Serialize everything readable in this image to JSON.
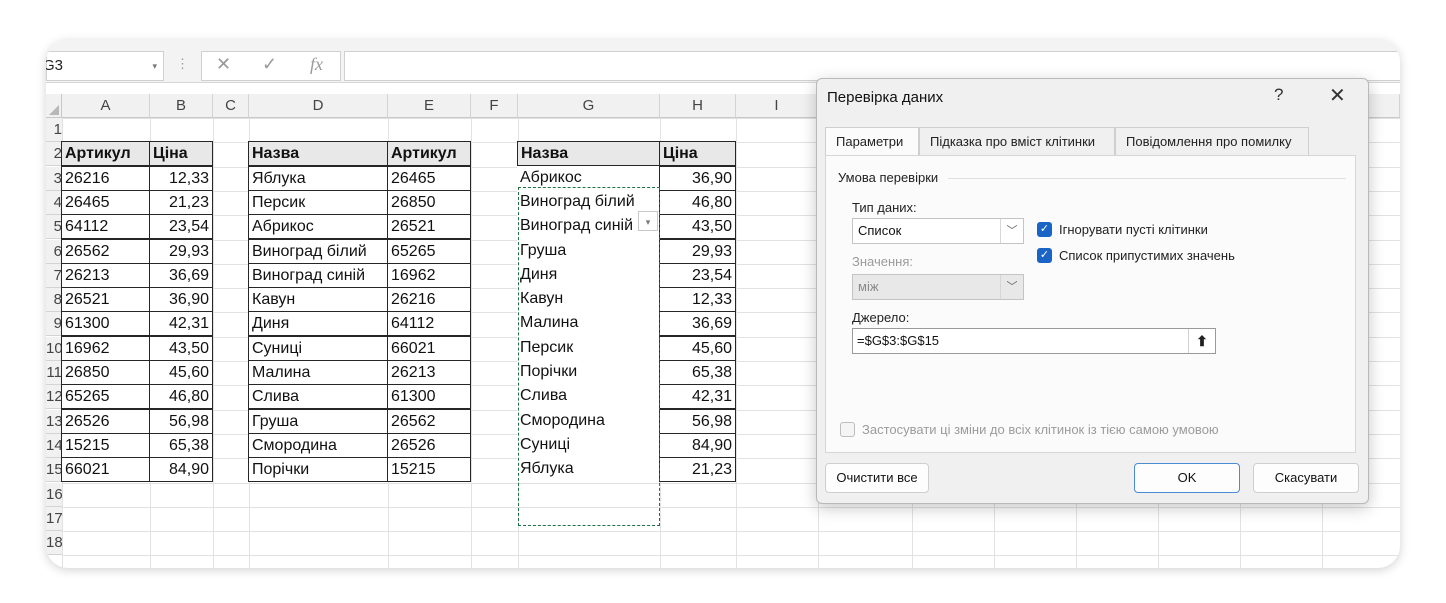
{
  "formula_bar": {
    "name_box": "G3",
    "fx": "fx",
    "cancel_glyph": "✕",
    "enter_glyph": "✓",
    "dropdown_glyph": "▾",
    "separator": "⋮"
  },
  "columns": [
    "A",
    "B",
    "C",
    "D",
    "E",
    "F",
    "G",
    "H",
    "I"
  ],
  "rows": [
    "1",
    "2",
    "3",
    "4",
    "5",
    "6",
    "7",
    "8",
    "9",
    "10",
    "11",
    "12",
    "13",
    "14",
    "15",
    "16",
    "17",
    "18"
  ],
  "table1": {
    "headers": [
      "Артикул",
      "Ціна"
    ],
    "rows": [
      [
        "26216",
        "12,33"
      ],
      [
        "26465",
        "21,23"
      ],
      [
        "64112",
        "23,54"
      ],
      [
        "26562",
        "29,93"
      ],
      [
        "26213",
        "36,69"
      ],
      [
        "26521",
        "36,90"
      ],
      [
        "61300",
        "42,31"
      ],
      [
        "16962",
        "43,50"
      ],
      [
        "26850",
        "45,60"
      ],
      [
        "65265",
        "46,80"
      ],
      [
        "26526",
        "56,98"
      ],
      [
        "15215",
        "65,38"
      ],
      [
        "66021",
        "84,90"
      ]
    ]
  },
  "table2": {
    "headers": [
      "Назва",
      "Артикул"
    ],
    "rows": [
      [
        "Яблука",
        "26465"
      ],
      [
        "Персик",
        "26850"
      ],
      [
        "Абрикос",
        "26521"
      ],
      [
        "Виноград білий",
        "65265"
      ],
      [
        "Виноград синій",
        "16962"
      ],
      [
        "Кавун",
        "26216"
      ],
      [
        "Диня",
        "64112"
      ],
      [
        "Суниці",
        "66021"
      ],
      [
        "Малина",
        "26213"
      ],
      [
        "Слива",
        "61300"
      ],
      [
        "Груша",
        "26562"
      ],
      [
        "Смородина",
        "26526"
      ],
      [
        "Порічки",
        "15215"
      ]
    ]
  },
  "table3": {
    "headers": [
      "Назва",
      "Ціна"
    ],
    "rows": [
      [
        "Абрикос",
        "36,90"
      ],
      [
        "Виноград білий",
        "46,80"
      ],
      [
        "Виноград синій",
        "43,50"
      ],
      [
        "Груша",
        "29,93"
      ],
      [
        "Диня",
        "23,54"
      ],
      [
        "Кавун",
        "12,33"
      ],
      [
        "Малина",
        "36,69"
      ],
      [
        "Персик",
        "45,60"
      ],
      [
        "Порічки",
        "65,38"
      ],
      [
        "Слива",
        "42,31"
      ],
      [
        "Смородина",
        "56,98"
      ],
      [
        "Суниці",
        "84,90"
      ],
      [
        "Яблука",
        "21,23"
      ]
    ]
  },
  "dialog": {
    "title": "Перевірка даних",
    "help": "?",
    "close": "✕",
    "tabs": [
      "Параметри",
      "Підказка про вміст клітинки",
      "Повідомлення про помилку"
    ],
    "section_title": "Умова перевірки",
    "data_type_label": "Тип даних:",
    "data_type_value": "Список",
    "ignore_blank_label": "Ігнорувати пусті клітинки",
    "ignore_blank_checked": true,
    "in_cell_dropdown_label": "Список припустимих значень",
    "in_cell_dropdown_checked": true,
    "value_label": "Значення:",
    "value_value": "між",
    "source_label": "Джерело:",
    "source_value": "=$G$3:$G$15",
    "source_btn_glyph": "⬆",
    "apply_all_label": "Застосувати ці зміни до всіх клітинок із тією самою умовою",
    "apply_all_checked": false,
    "clear_all": "Очистити все",
    "ok": "OK",
    "cancel": "Скасувати",
    "chevron_glyph": "﹀"
  },
  "colors": {
    "checkbox": "#1a64c5",
    "marquee": "#1e7145",
    "header_fill": "#e8e8e8"
  }
}
